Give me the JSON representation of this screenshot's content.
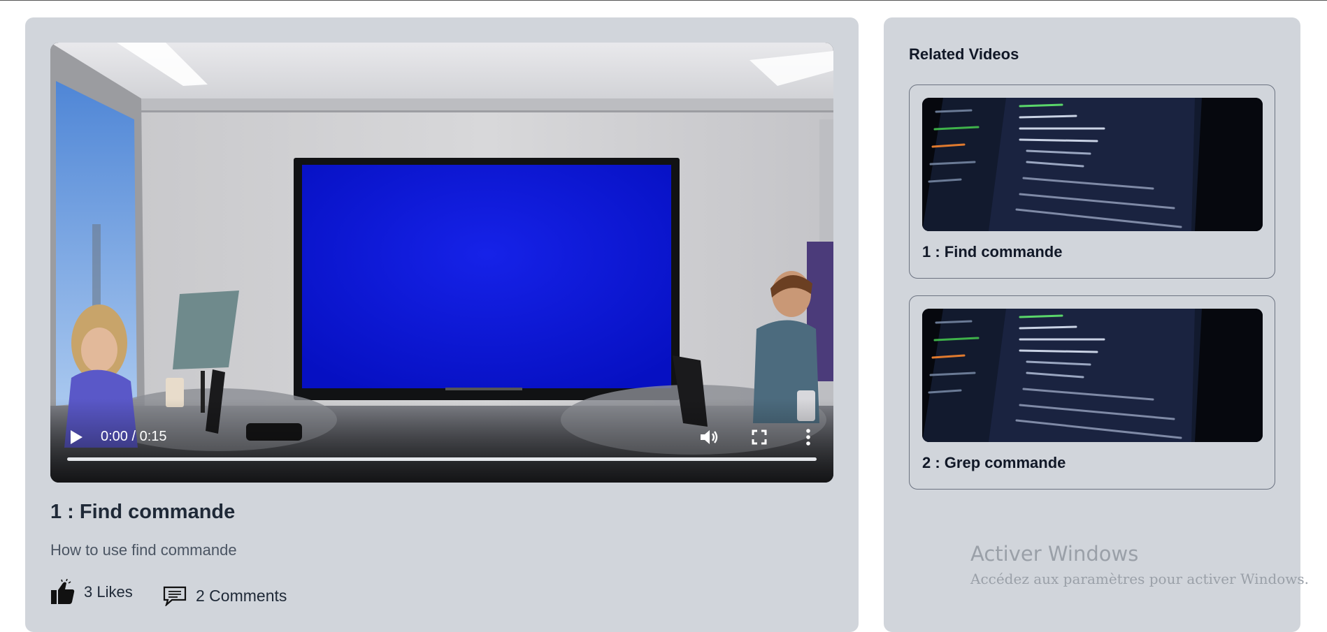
{
  "player": {
    "current_time": "0:00",
    "duration": "0:15",
    "time_display": "0:00 / 0:15",
    "progress": 0,
    "icons": [
      "play-icon",
      "volume-icon",
      "fullscreen-icon",
      "more-options-icon"
    ]
  },
  "video": {
    "title": "1 : Find commande",
    "description": "How to use find commande",
    "likes_label": "3 Likes",
    "comments_label": "2 Comments"
  },
  "related": {
    "heading": "Related Videos",
    "items": [
      {
        "title": "1 : Find commande"
      },
      {
        "title": "2 : Grep commande"
      }
    ]
  },
  "watermark": {
    "title": "Activer Windows",
    "subtitle": "Accédez aux paramètres pour activer Windows."
  },
  "colors": {
    "panel_bg": "#d1d5db",
    "screen_blue": "#0a14d6",
    "text_dark": "#1f2937",
    "watermark": "#9aa0a8"
  }
}
